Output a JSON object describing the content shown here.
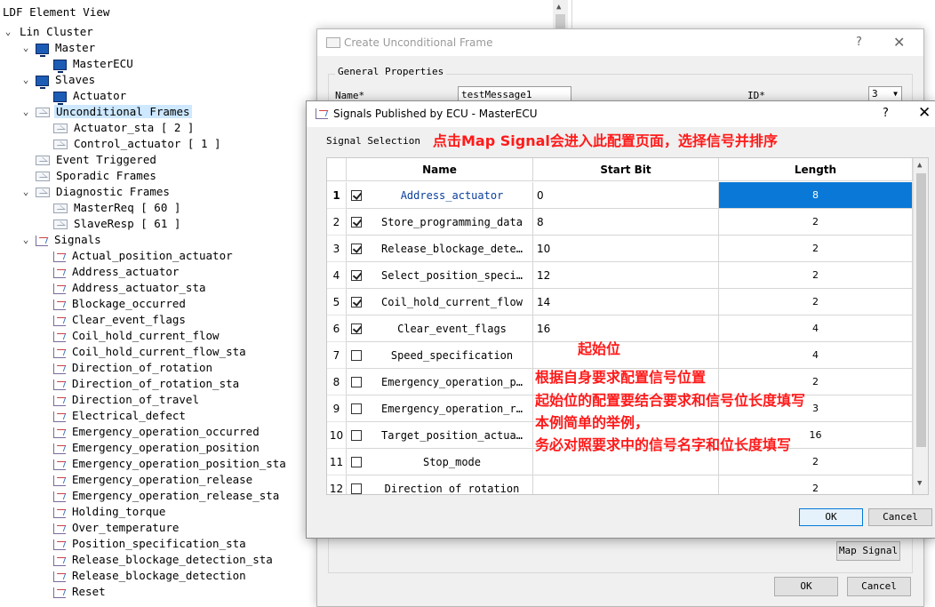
{
  "tree": {
    "title": "LDF Element View",
    "nodes": [
      {
        "label": "Lin Cluster",
        "icon": "none",
        "expanded": true
      },
      {
        "label": "Master",
        "icon": "monitor-icon",
        "expanded": true
      },
      {
        "label": "MasterECU",
        "icon": "monitor-icon"
      },
      {
        "label": "Slaves",
        "icon": "monitor-icon",
        "expanded": true
      },
      {
        "label": "Actuator",
        "icon": "monitor-icon"
      },
      {
        "label": "Unconditional Frames",
        "icon": "envelope-icon",
        "expanded": true,
        "selected": true
      },
      {
        "label": "Actuator_sta [ 2 ]",
        "icon": "envelope-icon"
      },
      {
        "label": "Control_actuator [ 1 ]",
        "icon": "envelope-icon"
      },
      {
        "label": "Event Triggered",
        "icon": "envelope-icon"
      },
      {
        "label": "Sporadic Frames",
        "icon": "envelope-icon"
      },
      {
        "label": "Diagnostic Frames",
        "icon": "envelope-icon",
        "expanded": true
      },
      {
        "label": "MasterReq [ 60 ]",
        "icon": "envelope-icon"
      },
      {
        "label": "SlaveResp [ 61 ]",
        "icon": "envelope-icon"
      },
      {
        "label": "Signals",
        "icon": "signal-icon",
        "expanded": true
      },
      {
        "label": "Actual_position_actuator",
        "icon": "signal-icon"
      },
      {
        "label": "Address_actuator",
        "icon": "signal-icon"
      },
      {
        "label": "Address_actuator_sta",
        "icon": "signal-icon"
      },
      {
        "label": "Blockage_occurred",
        "icon": "signal-icon"
      },
      {
        "label": "Clear_event_flags",
        "icon": "signal-icon"
      },
      {
        "label": "Coil_hold_current_flow",
        "icon": "signal-icon"
      },
      {
        "label": "Coil_hold_current_flow_sta",
        "icon": "signal-icon"
      },
      {
        "label": "Direction_of_rotation",
        "icon": "signal-icon"
      },
      {
        "label": "Direction_of_rotation_sta",
        "icon": "signal-icon"
      },
      {
        "label": "Direction_of_travel",
        "icon": "signal-icon"
      },
      {
        "label": "Electrical_defect",
        "icon": "signal-icon"
      },
      {
        "label": "Emergency_operation_occurred",
        "icon": "signal-icon"
      },
      {
        "label": "Emergency_operation_position",
        "icon": "signal-icon"
      },
      {
        "label": "Emergency_operation_position_sta",
        "icon": "signal-icon"
      },
      {
        "label": "Emergency_operation_release",
        "icon": "signal-icon"
      },
      {
        "label": "Emergency_operation_release_sta",
        "icon": "signal-icon"
      },
      {
        "label": "Holding_torque",
        "icon": "signal-icon"
      },
      {
        "label": "Over_temperature",
        "icon": "signal-icon"
      },
      {
        "label": "Position_specification_sta",
        "icon": "signal-icon"
      },
      {
        "label": "Release_blockage_detection_sta",
        "icon": "signal-icon"
      },
      {
        "label": "Release_blockage_detection",
        "icon": "signal-icon"
      },
      {
        "label": "Reset",
        "icon": "signal-icon"
      }
    ]
  },
  "unconditional_dialog": {
    "title": "Create Unconditional Frame",
    "help": "?",
    "close": "✕",
    "group_label": "General Properties",
    "name_label": "Name*",
    "name_value": "testMessage1",
    "id_label": "ID*",
    "id_value": "3",
    "map_signal": "Map Signal",
    "ok": "OK",
    "cancel": "Cancel"
  },
  "signals_dialog": {
    "title": "Signals Published by ECU - MasterECU",
    "help": "?",
    "close": "✕",
    "selection_label": "Signal Selection",
    "headers": {
      "name": "Name",
      "start": "Start Bit",
      "length": "Length"
    },
    "rows": [
      {
        "n": "1",
        "checked": true,
        "name": "Address_actuator",
        "start": "0",
        "length": "8",
        "selected": true
      },
      {
        "n": "2",
        "checked": true,
        "name": "Store_programming_data",
        "start": "8",
        "length": "2"
      },
      {
        "n": "3",
        "checked": true,
        "name": "Release_blockage_dete…",
        "start": "10",
        "length": "2"
      },
      {
        "n": "4",
        "checked": true,
        "name": "Select_position_speci…",
        "start": "12",
        "length": "2"
      },
      {
        "n": "5",
        "checked": true,
        "name": "Coil_hold_current_flow",
        "start": "14",
        "length": "2"
      },
      {
        "n": "6",
        "checked": true,
        "name": "Clear_event_flags",
        "start": "16",
        "length": "4"
      },
      {
        "n": "7",
        "checked": false,
        "name": "Speed_specification",
        "start": "",
        "length": "4"
      },
      {
        "n": "8",
        "checked": false,
        "name": "Emergency_operation_p…",
        "start": "",
        "length": "2"
      },
      {
        "n": "9",
        "checked": false,
        "name": "Emergency_operation_r…",
        "start": "",
        "length": "3"
      },
      {
        "n": "10",
        "checked": false,
        "name": "Target_position_actua…",
        "start": "",
        "length": "16"
      },
      {
        "n": "11",
        "checked": false,
        "name": "Stop_mode",
        "start": "",
        "length": "2"
      },
      {
        "n": "12",
        "checked": false,
        "name": "Direction_of_rotation",
        "start": "",
        "length": "2"
      }
    ],
    "ok": "OK",
    "cancel": "Cancel"
  },
  "annotations": {
    "top": "点击Map Signal会进入此配置页面，选择信号并排序",
    "start_bit": "起始位",
    "lines": [
      "根据自身要求配置信号位置",
      "起始位的配置要结合要求和信号位长度填写",
      "本例简单的举例，",
      "务必对照要求中的信号名字和位长度填写"
    ]
  },
  "colors": {
    "selection_blue": "#0a78d7",
    "tree_selection": "#cde8ff",
    "annotation_red": "#ff1a1a"
  }
}
